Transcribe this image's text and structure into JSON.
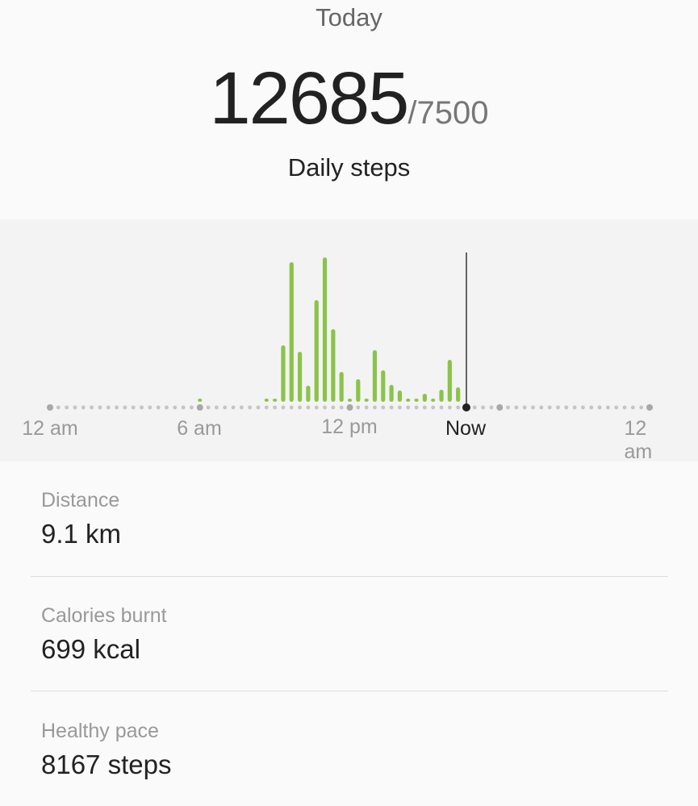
{
  "header": {
    "period": "Today",
    "steps": "12685",
    "goal": "/7500",
    "label": "Daily steps"
  },
  "chart_data": {
    "type": "bar",
    "xlabel": "",
    "ylabel": "",
    "x_range": [
      "00:00",
      "24:00"
    ],
    "bin_minutes": 20,
    "tick_labels": [
      "12 am",
      "6 am",
      "12 pm",
      "Now",
      "12 am"
    ],
    "now": "16:40",
    "bar_color": "#8bc34a",
    "categories": [
      "06:00",
      "08:40",
      "09:00",
      "09:20",
      "09:40",
      "10:00",
      "10:20",
      "10:40",
      "11:00",
      "11:20",
      "11:40",
      "12:00",
      "12:20",
      "12:40",
      "13:00",
      "13:20",
      "13:40",
      "14:00",
      "14:20",
      "14:40",
      "15:00",
      "15:20",
      "15:40",
      "16:00",
      "16:20"
    ],
    "values": [
      36,
      36,
      36,
      847,
      2094,
      750,
      242,
      1525,
      2166,
      1089,
      448,
      48,
      339,
      48,
      774,
      472,
      254,
      169,
      48,
      48,
      121,
      48,
      182,
      629,
      218
    ]
  },
  "stats": [
    {
      "title": "Distance",
      "value": "9.1 km"
    },
    {
      "title": "Calories burnt",
      "value": "699 kcal"
    },
    {
      "title": "Healthy pace",
      "value": "8167 steps"
    }
  ]
}
